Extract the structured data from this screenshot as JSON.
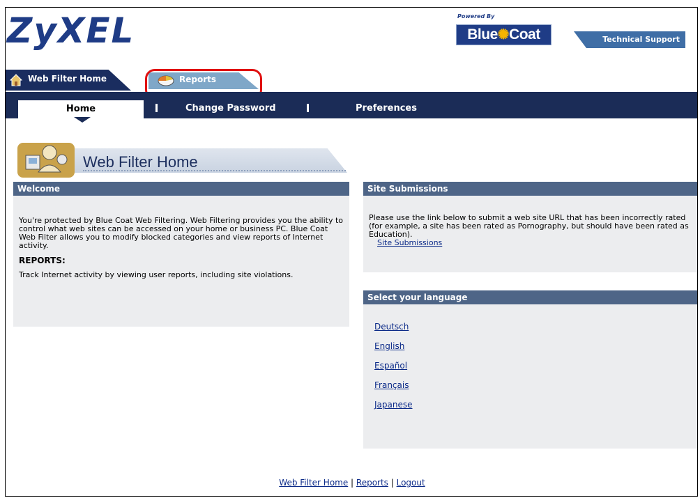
{
  "brand": {
    "logo": "ZyXEL",
    "powered_by": "Powered By",
    "partner": "Blue",
    "partner_b": "Coat",
    "tech_support": "Technical Support"
  },
  "tabs": [
    {
      "label": "Web Filter Home",
      "icon": "house-icon",
      "active": true
    },
    {
      "label": "Reports",
      "icon": "pie-chart-icon",
      "active": false
    }
  ],
  "nav": {
    "items": [
      "Home",
      "Change Password",
      "Preferences"
    ],
    "active": "Home"
  },
  "page_header": {
    "title": "Web Filter Home",
    "icon": "users-icon"
  },
  "welcome": {
    "title": "Welcome",
    "body": "You're protected by Blue Coat Web Filtering. Web Filtering provides you the ability to control what web sites can be accessed on your home or business PC. Blue Coat Web Filter allows you to modify blocked categories and view reports of Internet activity.",
    "reports_heading": "REPORTS:",
    "reports_body": "Track Internet activity by viewing user reports, including site violations."
  },
  "site_submissions": {
    "title": "Site Submissions",
    "body": "Please use the link below to submit a web site URL that has been incorrectly rated (for example, a site has been rated as Pornography, but should have been rated as Education).",
    "link": "Site Submissions"
  },
  "language": {
    "title": "Select your language",
    "options": [
      "Deutsch",
      "English",
      "Español",
      "Français",
      "Japanese"
    ]
  },
  "footer": {
    "links": [
      "Web Filter Home",
      "Reports",
      "Logout"
    ],
    "separator": " | "
  },
  "colors": {
    "navy": "#1b2c57",
    "panel_header": "#4e6587",
    "panel_bg": "#ecedef",
    "highlight": "#e01010"
  }
}
